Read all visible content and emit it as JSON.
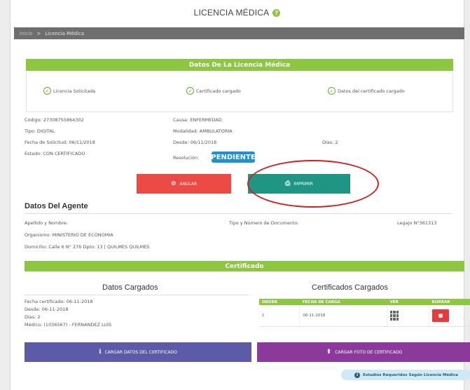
{
  "page": {
    "title": "LICENCIA MÉDICA"
  },
  "breadcrumb": {
    "home": "Inicio",
    "separator": ">",
    "current": "Licencia Médica"
  },
  "licencia": {
    "header": "Datos De La Licencia Médica",
    "steps": [
      {
        "label": "Licencia Solicitada"
      },
      {
        "label": "Certificado cargado"
      },
      {
        "label": "Datos del certificado cargado"
      }
    ],
    "codigo": "Código: 27308755864302",
    "tipo": "Tipo: DIGITAL",
    "fecha_solicitud": "Fecha de Solicitud: 06/11/2018",
    "estado": "Estado: CON CERTIFICADO",
    "causa": "Causa: ENFERMEDAD",
    "modalidad": "Modalidad: AMBULATORIA",
    "desde": "Desde: 06/11/2018",
    "dias": "Días: 2",
    "resolucion_label": "Resolución:",
    "resolucion_value": "PENDIENTE"
  },
  "actions": {
    "anular": "ANULAR",
    "imprimir": "IMPRIMIR"
  },
  "agente": {
    "title": "Datos Del Agente",
    "apellido_label": "Apellido y Nombre:",
    "documento_label": "Tipo y Número de Documento:",
    "legajo": "Legajo N°361313",
    "organismo": "Organismo: MINISTERIO DE ECONOMIA",
    "domicilio": "Domicilio: Calle 6 N° 276 Dpto: 13 | QUILMES QUILMES"
  },
  "certificado": {
    "header": "Certificado",
    "datos_title": "Datos Cargados",
    "fecha_certificado": "Fecha certificado: 06-11-2018",
    "desde": "Desde: 06-11-2018",
    "dias": "Días: 2",
    "medico": "Médico: (1036567) - FERNANDEZ LUIS",
    "cargados_title": "Certificados Cargados",
    "table_headers": [
      "ORDEN",
      "FECHA DE CARGA",
      "VER",
      "BORRAR"
    ],
    "rows": [
      {
        "orden": "1",
        "fecha": "06-11-2018"
      }
    ]
  },
  "bottom_buttons": {
    "cargar_datos": "CARGAR DATOS DEL CERTIFICADO",
    "cargar_foto": "CARGAR FOTO DE CERTIFICADO"
  },
  "info_pill": "Estudios Requeridos Según Licencia Médica",
  "colors": {
    "green": "#8dc63f",
    "red_button": "#ec4a44",
    "teal_button": "#1e9683",
    "blue_badge": "#1e90d8",
    "purple_button": "#5b5ba8",
    "magenta_button": "#8b3a9c"
  }
}
